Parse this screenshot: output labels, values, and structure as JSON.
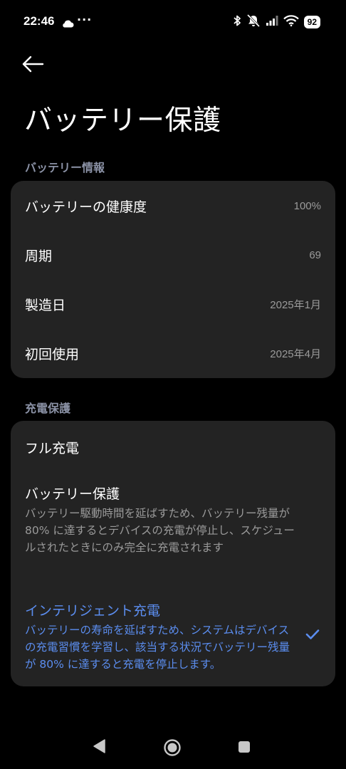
{
  "status_bar": {
    "time": "22:46",
    "dots": "···",
    "battery_level": "92"
  },
  "header": {
    "title": "バッテリー保護"
  },
  "battery_info": {
    "section_label": "バッテリー情報",
    "rows": [
      {
        "label": "バッテリーの健康度",
        "value": "100%"
      },
      {
        "label": "周期",
        "value": "69"
      },
      {
        "label": "製造日",
        "value": "2025年1月"
      },
      {
        "label": "初回使用",
        "value": "2025年4月"
      }
    ]
  },
  "charge_protection": {
    "section_label": "充電保護",
    "options": [
      {
        "title": "フル充電",
        "description": ""
      },
      {
        "title": "バッテリー保護",
        "description": "バッテリー駆動時間を延ばすため、バッテリー残量が 80% に達するとデバイスの充電が停止し、スケジュールされたときにのみ完全に充電されます"
      },
      {
        "title": "インテリジェント充電",
        "description": "バッテリーの寿命を延ばすため、システムはデバイスの充電習慣を学習し、該当する状況でバッテリー残量が 80% に達すると充電を停止します。"
      }
    ],
    "selected_index": 2
  },
  "colors": {
    "accent": "#5b8def",
    "card_bg": "#232323",
    "section_label": "#8b92a6",
    "secondary_text": "#9a9a9a"
  },
  "icons": {
    "back": "arrow-left-icon",
    "check": "check-icon",
    "nav_back": "triangle-back-icon",
    "nav_home": "circle-home-icon",
    "nav_recents": "square-recents-icon"
  }
}
